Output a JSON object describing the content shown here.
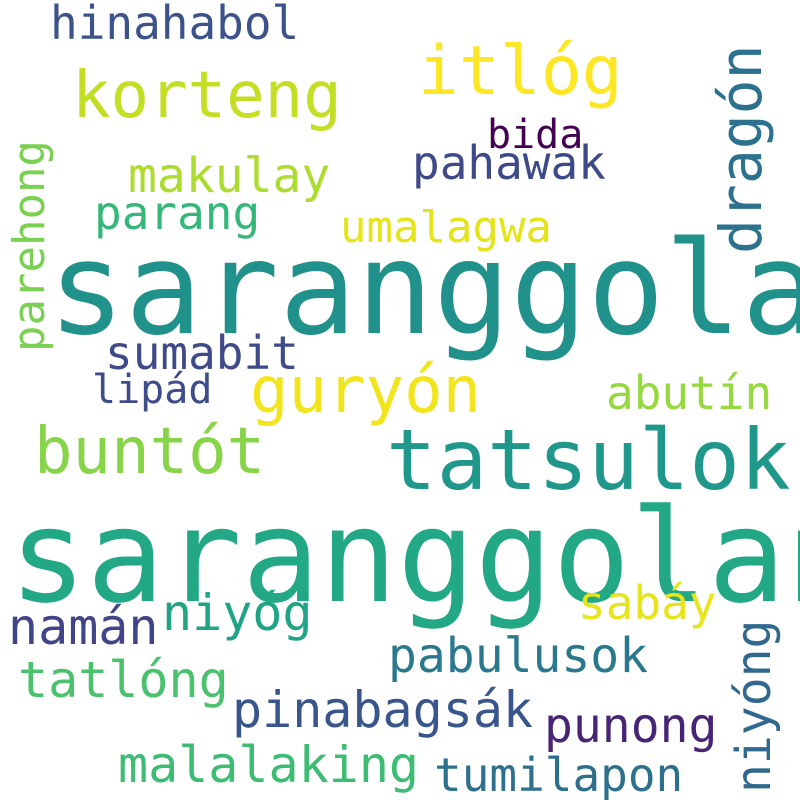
{
  "words": [
    {
      "text": "saranggola",
      "color": "#21918c"
    },
    {
      "text": "saranggolang",
      "color": "#22a884"
    },
    {
      "text": "tatsulok",
      "color": "#1f988b"
    },
    {
      "text": "dragón",
      "color": "#2c728e"
    },
    {
      "text": "itlóg",
      "color": "#fde725"
    },
    {
      "text": "korteng",
      "color": "#c2df23"
    },
    {
      "text": "guryón",
      "color": "#f2e51d"
    },
    {
      "text": "buntót",
      "color": "#86d549"
    },
    {
      "text": "hinahabol",
      "color": "#3b528b"
    },
    {
      "text": "bida",
      "color": "#440154"
    },
    {
      "text": "pahawak",
      "color": "#3e4989"
    },
    {
      "text": "makulay",
      "color": "#addc30"
    },
    {
      "text": "parang",
      "color": "#35b779"
    },
    {
      "text": "umalagwa",
      "color": "#e5e419"
    },
    {
      "text": "parehong",
      "color": "#7ad151"
    },
    {
      "text": "sumabit",
      "color": "#3e4a89"
    },
    {
      "text": "lipád",
      "color": "#3e4c8a"
    },
    {
      "text": "abutín",
      "color": "#95d840"
    },
    {
      "text": "sabáy",
      "color": "#e7e419"
    },
    {
      "text": "namán",
      "color": "#414487"
    },
    {
      "text": "niyóg",
      "color": "#20a486"
    },
    {
      "text": "pabulusok",
      "color": "#2a788e"
    },
    {
      "text": "niyóng",
      "color": "#31688e"
    },
    {
      "text": "tatlóng",
      "color": "#4ac16d"
    },
    {
      "text": "pinabagsák",
      "color": "#39568c"
    },
    {
      "text": "punong",
      "color": "#482475"
    },
    {
      "text": "malalaking",
      "color": "#3dbc74"
    },
    {
      "text": "tumilapon",
      "color": "#2d708e"
    }
  ]
}
